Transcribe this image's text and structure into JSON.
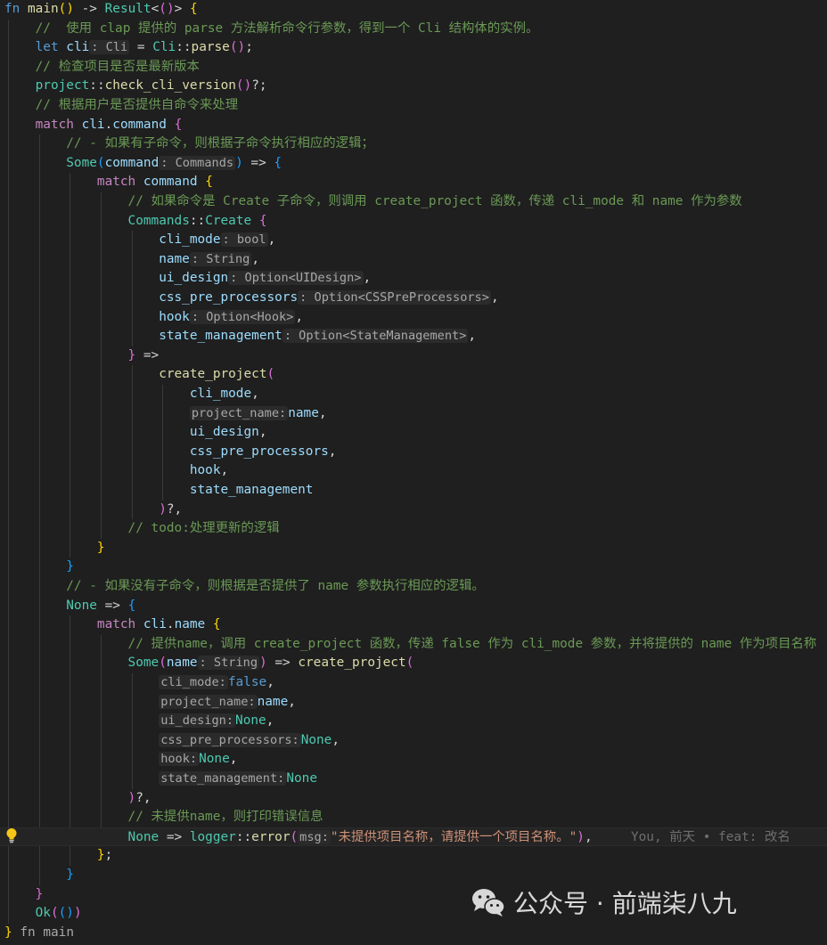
{
  "editor": {
    "lines": [
      {
        "indent": 0,
        "tokens": [
          [
            "kw",
            "fn "
          ],
          [
            "fn",
            "main"
          ],
          [
            "b1",
            "()"
          ],
          [
            "op",
            " -> "
          ],
          [
            "ty",
            "Result"
          ],
          [
            "op",
            "<"
          ],
          [
            "b2",
            "()"
          ],
          [
            "op",
            "> "
          ],
          [
            "b1",
            "{"
          ]
        ]
      },
      {
        "indent": 1,
        "tokens": [
          [
            "com",
            "//  使用 clap 提供的 parse 方法解析命令行参数，得到一个 Cli 结构体的实例。"
          ]
        ]
      },
      {
        "indent": 1,
        "tokens": [
          [
            "kw",
            "let "
          ],
          [
            "var",
            "cli"
          ],
          [
            "hint",
            ": Cli"
          ],
          [
            "op",
            " = "
          ],
          [
            "ty",
            "Cli"
          ],
          [
            "op",
            "::"
          ],
          [
            "fn",
            "parse"
          ],
          [
            "b2",
            "()"
          ],
          [
            "op",
            ";"
          ]
        ]
      },
      {
        "indent": 1,
        "tokens": [
          [
            "com",
            "// 检查项目是否是最新版本"
          ]
        ]
      },
      {
        "indent": 1,
        "tokens": [
          [
            "ty",
            "project"
          ],
          [
            "op",
            "::"
          ],
          [
            "fn",
            "check_cli_version"
          ],
          [
            "b2",
            "()"
          ],
          [
            "op",
            "?;"
          ]
        ]
      },
      {
        "indent": 1,
        "tokens": [
          [
            "com",
            "// 根据用户是否提供自命令来处理"
          ]
        ]
      },
      {
        "indent": 1,
        "tokens": [
          [
            "kw2",
            "match "
          ],
          [
            "var",
            "cli"
          ],
          [
            "op",
            "."
          ],
          [
            "var",
            "command"
          ],
          [
            "op",
            " "
          ],
          [
            "b2",
            "{"
          ]
        ]
      },
      {
        "indent": 2,
        "tokens": [
          [
            "com",
            "// - 如果有子命令，则根据子命令执行相应的逻辑；"
          ]
        ]
      },
      {
        "indent": 2,
        "tokens": [
          [
            "ty",
            "Some"
          ],
          [
            "b3",
            "("
          ],
          [
            "var",
            "command"
          ],
          [
            "hint",
            ": Commands"
          ],
          [
            "b3",
            ")"
          ],
          [
            "op",
            " => "
          ],
          [
            "b3",
            "{"
          ]
        ]
      },
      {
        "indent": 3,
        "tokens": [
          [
            "kw2",
            "match "
          ],
          [
            "var",
            "command"
          ],
          [
            "op",
            " "
          ],
          [
            "b1",
            "{"
          ]
        ]
      },
      {
        "indent": 4,
        "tokens": [
          [
            "com",
            "// 如果命令是 Create 子命令，则调用 create_project 函数，传递 cli_mode 和 name 作为参数"
          ]
        ]
      },
      {
        "indent": 4,
        "tokens": [
          [
            "ty",
            "Commands"
          ],
          [
            "op",
            "::"
          ],
          [
            "ty",
            "Create"
          ],
          [
            "op",
            " "
          ],
          [
            "b2",
            "{"
          ]
        ]
      },
      {
        "indent": 5,
        "tokens": [
          [
            "var",
            "cli_mode"
          ],
          [
            "hint",
            ": bool"
          ],
          [
            "op",
            ","
          ]
        ]
      },
      {
        "indent": 5,
        "tokens": [
          [
            "var",
            "name"
          ],
          [
            "hint",
            ": String"
          ],
          [
            "op",
            ","
          ]
        ]
      },
      {
        "indent": 5,
        "tokens": [
          [
            "var",
            "ui_design"
          ],
          [
            "hint",
            ": Option<UIDesign>"
          ],
          [
            "op",
            ","
          ]
        ]
      },
      {
        "indent": 5,
        "tokens": [
          [
            "var",
            "css_pre_processors"
          ],
          [
            "hint",
            ": Option<CSSPreProcessors>"
          ],
          [
            "op",
            ","
          ]
        ]
      },
      {
        "indent": 5,
        "tokens": [
          [
            "var",
            "hook"
          ],
          [
            "hint",
            ": Option<Hook>"
          ],
          [
            "op",
            ","
          ]
        ]
      },
      {
        "indent": 5,
        "tokens": [
          [
            "var",
            "state_management"
          ],
          [
            "hint",
            ": Option<StateManagement>"
          ],
          [
            "op",
            ","
          ]
        ]
      },
      {
        "indent": 4,
        "tokens": [
          [
            "b2",
            "}"
          ],
          [
            "op",
            " =>"
          ]
        ]
      },
      {
        "indent": 5,
        "tokens": [
          [
            "fn",
            "create_project"
          ],
          [
            "b2",
            "("
          ]
        ]
      },
      {
        "indent": 6,
        "tokens": [
          [
            "var",
            "cli_mode"
          ],
          [
            "op",
            ","
          ]
        ]
      },
      {
        "indent": 6,
        "tokens": [
          [
            "hint",
            "project_name:"
          ],
          [
            "var",
            "name"
          ],
          [
            "op",
            ","
          ]
        ]
      },
      {
        "indent": 6,
        "tokens": [
          [
            "var",
            "ui_design"
          ],
          [
            "op",
            ","
          ]
        ]
      },
      {
        "indent": 6,
        "tokens": [
          [
            "var",
            "css_pre_processors"
          ],
          [
            "op",
            ","
          ]
        ]
      },
      {
        "indent": 6,
        "tokens": [
          [
            "var",
            "hook"
          ],
          [
            "op",
            ","
          ]
        ]
      },
      {
        "indent": 6,
        "tokens": [
          [
            "var",
            "state_management"
          ]
        ]
      },
      {
        "indent": 5,
        "tokens": [
          [
            "b2",
            ")"
          ],
          [
            "op",
            "?,"
          ]
        ]
      },
      {
        "indent": 4,
        "tokens": [
          [
            "com",
            "// todo:处理更新的逻辑"
          ]
        ]
      },
      {
        "indent": 3,
        "tokens": [
          [
            "b1",
            "}"
          ]
        ]
      },
      {
        "indent": 2,
        "tokens": [
          [
            "b3",
            "}"
          ]
        ]
      },
      {
        "indent": 2,
        "tokens": [
          [
            "com",
            "// - 如果没有子命令，则根据是否提供了 name 参数执行相应的逻辑。"
          ]
        ]
      },
      {
        "indent": 2,
        "tokens": [
          [
            "ty",
            "None"
          ],
          [
            "op",
            " => "
          ],
          [
            "b3",
            "{"
          ]
        ]
      },
      {
        "indent": 3,
        "tokens": [
          [
            "kw2",
            "match "
          ],
          [
            "var",
            "cli"
          ],
          [
            "op",
            "."
          ],
          [
            "var",
            "name"
          ],
          [
            "op",
            " "
          ],
          [
            "b1",
            "{"
          ]
        ]
      },
      {
        "indent": 4,
        "tokens": [
          [
            "com",
            "// 提供name，调用 create_project 函数，传递 false 作为 cli_mode 参数，并将提供的 name 作为项目名称"
          ]
        ]
      },
      {
        "indent": 4,
        "tokens": [
          [
            "ty",
            "Some"
          ],
          [
            "b2",
            "("
          ],
          [
            "var",
            "name"
          ],
          [
            "hint",
            ": String"
          ],
          [
            "b2",
            ")"
          ],
          [
            "op",
            " => "
          ],
          [
            "fn",
            "create_project"
          ],
          [
            "b2",
            "("
          ]
        ]
      },
      {
        "indent": 5,
        "tokens": [
          [
            "hint",
            "cli_mode:"
          ],
          [
            "const",
            "false"
          ],
          [
            "op",
            ","
          ]
        ]
      },
      {
        "indent": 5,
        "tokens": [
          [
            "hint",
            "project_name:"
          ],
          [
            "var",
            "name"
          ],
          [
            "op",
            ","
          ]
        ]
      },
      {
        "indent": 5,
        "tokens": [
          [
            "hint",
            "ui_design:"
          ],
          [
            "ty",
            "None"
          ],
          [
            "op",
            ","
          ]
        ]
      },
      {
        "indent": 5,
        "tokens": [
          [
            "hint",
            "css_pre_processors:"
          ],
          [
            "ty",
            "None"
          ],
          [
            "op",
            ","
          ]
        ]
      },
      {
        "indent": 5,
        "tokens": [
          [
            "hint",
            "hook:"
          ],
          [
            "ty",
            "None"
          ],
          [
            "op",
            ","
          ]
        ]
      },
      {
        "indent": 5,
        "tokens": [
          [
            "hint",
            "state_management:"
          ],
          [
            "ty",
            "None"
          ]
        ]
      },
      {
        "indent": 4,
        "tokens": [
          [
            "b2",
            ")"
          ],
          [
            "op",
            "?,"
          ]
        ]
      },
      {
        "indent": 4,
        "tokens": [
          [
            "com",
            "// 未提供name，则打印错误信息"
          ]
        ]
      },
      {
        "indent": 4,
        "current": true,
        "tokens": [
          [
            "ty",
            "None"
          ],
          [
            "op",
            " => "
          ],
          [
            "ty",
            "logger"
          ],
          [
            "op",
            "::"
          ],
          [
            "fn",
            "error"
          ],
          [
            "b2",
            "("
          ],
          [
            "hint",
            "msg:"
          ],
          [
            "str",
            "\"未提供项目名称，请提供一个项目名称。\""
          ],
          [
            "b2",
            ")"
          ],
          [
            "op",
            ","
          ],
          [
            "blame",
            "     You, 前天 • feat: 改名"
          ]
        ]
      },
      {
        "indent": 3,
        "tokens": [
          [
            "b1",
            "}"
          ],
          [
            "op",
            ";"
          ]
        ]
      },
      {
        "indent": 2,
        "tokens": [
          [
            "b3",
            "}"
          ]
        ]
      },
      {
        "indent": 1,
        "tokens": [
          [
            "b2",
            "}"
          ]
        ]
      },
      {
        "indent": 1,
        "tokens": [
          [
            "ty",
            "Ok"
          ],
          [
            "b2",
            "("
          ],
          [
            "b3",
            "("
          ],
          [
            "b3",
            ")"
          ],
          [
            "b2",
            ")"
          ]
        ]
      },
      {
        "indent": 0,
        "tokens": [
          [
            "b1",
            "}"
          ],
          [
            "hint-plain",
            " fn main"
          ]
        ]
      }
    ]
  },
  "watermark": {
    "text": "公众号 · 前端柒八九",
    "icon": "wechat-icon"
  },
  "icons": {
    "lightbulb": "lightbulb-icon"
  },
  "colors": {
    "background": "#1f1f1f",
    "keyword": "#569cd6",
    "control": "#c586c0",
    "function": "#dcdcaa",
    "type": "#4ec9b0",
    "variable": "#9cdcfe",
    "comment": "#6a9955",
    "string": "#ce9178"
  }
}
